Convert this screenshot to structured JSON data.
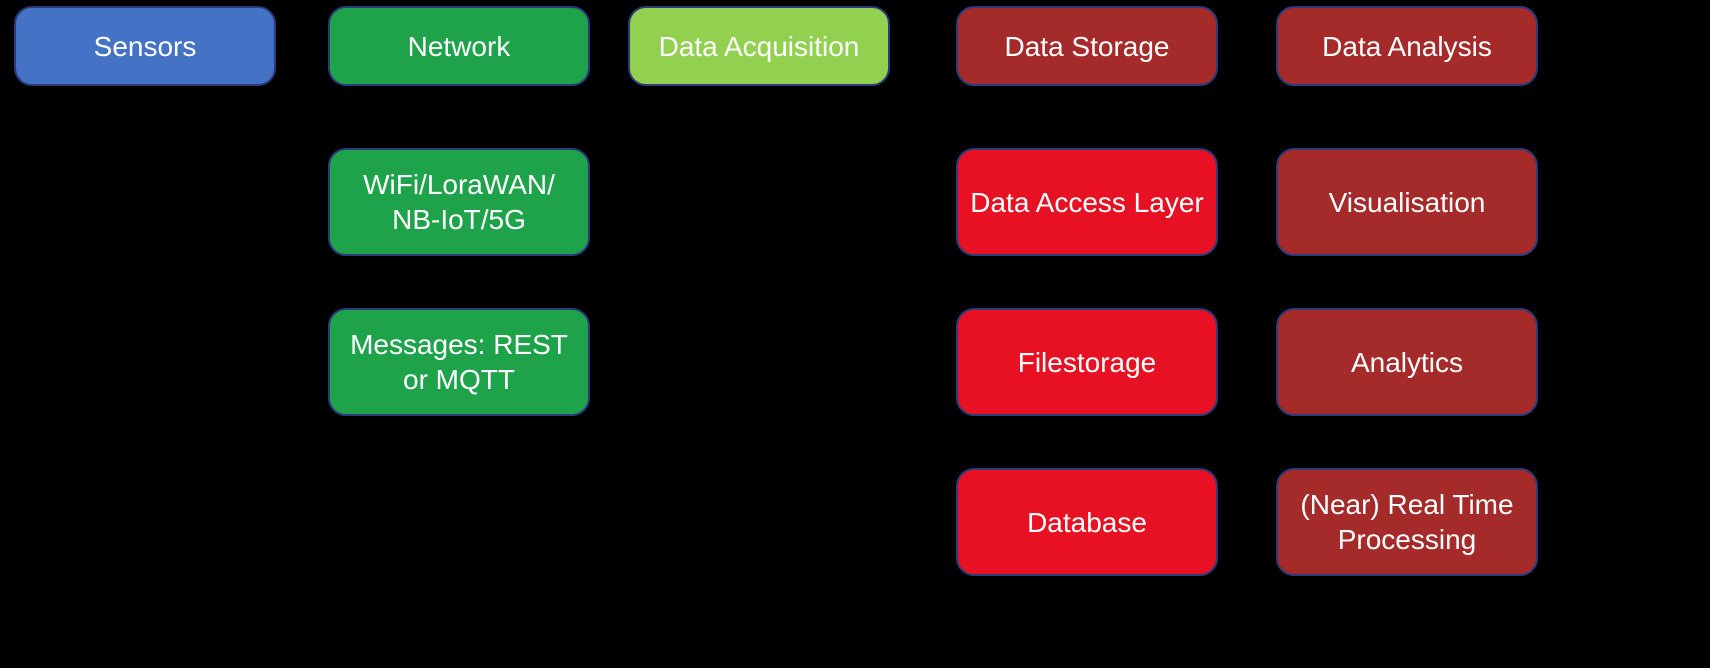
{
  "col1": {
    "header": "Sensors"
  },
  "col2": {
    "header": "Network",
    "r2": "WiFi/LoraWAN/ NB-IoT/5G",
    "r3": "Messages: REST or  MQTT"
  },
  "col3": {
    "header": "Data Acquisition"
  },
  "col4": {
    "header": "Data Storage",
    "r2": "Data Access Layer",
    "r3": "Filestorage",
    "r4": "Database"
  },
  "col5": {
    "header": "Data Analysis",
    "r2": "Visualisation",
    "r3": "Analytics",
    "r4": "(Near) Real Time Processing"
  }
}
